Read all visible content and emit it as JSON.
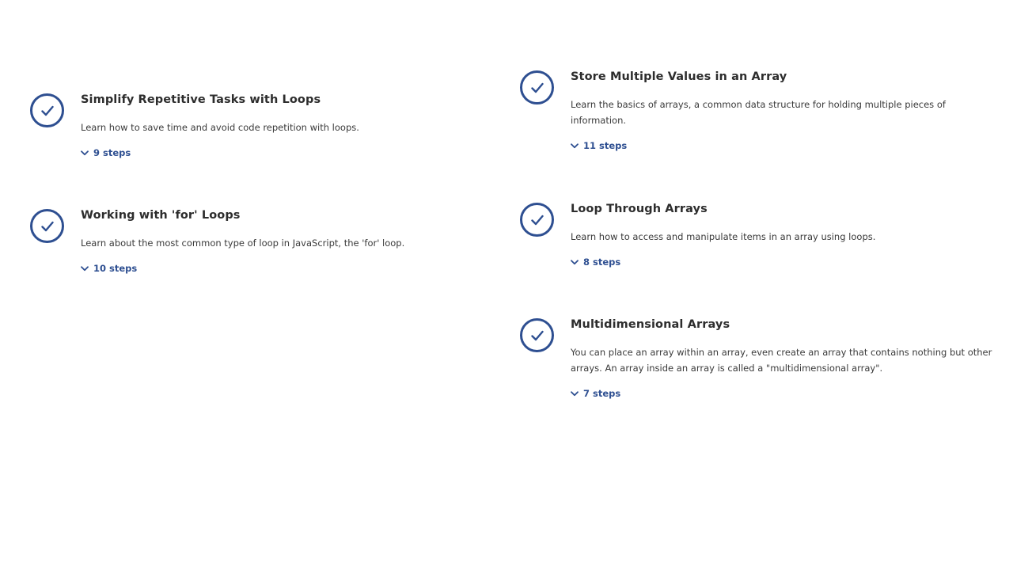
{
  "colors": {
    "accent": "#2e4f91",
    "title": "#2d2d2d",
    "text": "#3a3a3a",
    "background": "#ffffff"
  },
  "lessons_left": [
    {
      "title": "Simplify Repetitive Tasks with Loops",
      "description": "Learn how to save time and avoid code repetition with loops.",
      "steps": "9 steps",
      "status_icon": "check-circle-icon",
      "toggle_icon": "chevron-down-icon"
    },
    {
      "title": "Working with 'for' Loops",
      "description": "Learn about the most common type of loop in JavaScript, the 'for' loop.",
      "steps": "10 steps",
      "status_icon": "check-circle-icon",
      "toggle_icon": "chevron-down-icon"
    }
  ],
  "lessons_right": [
    {
      "title": "Store Multiple Values in an Array",
      "description": "Learn the basics of arrays, a common data structure for holding multiple pieces of information.",
      "steps": "11 steps",
      "status_icon": "check-circle-icon",
      "toggle_icon": "chevron-down-icon"
    },
    {
      "title": "Loop Through Arrays",
      "description": "Learn how to access and manipulate items in an array using loops.",
      "steps": "8 steps",
      "status_icon": "check-circle-icon",
      "toggle_icon": "chevron-down-icon"
    },
    {
      "title": "Multidimensional Arrays",
      "description": "You can place an array within an array, even create an array that contains nothing but other arrays. An array inside an array is called a \"multidimensional array\".",
      "steps": "7 steps",
      "status_icon": "check-circle-icon",
      "toggle_icon": "chevron-down-icon"
    }
  ]
}
